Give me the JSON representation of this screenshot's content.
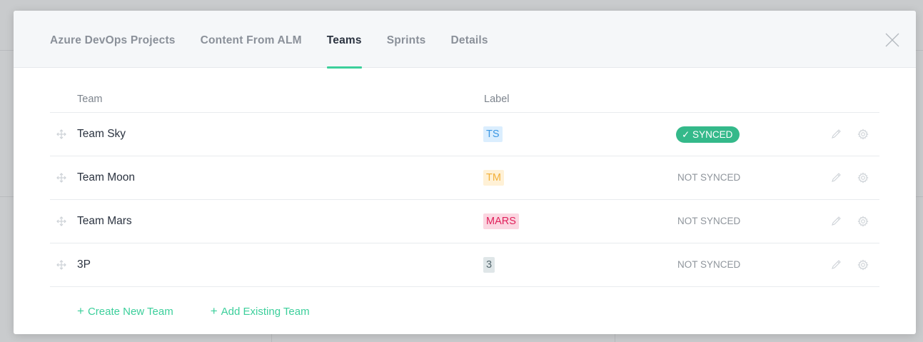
{
  "tabs": [
    {
      "label": "Azure DevOps Projects"
    },
    {
      "label": "Content From ALM"
    },
    {
      "label": "Teams"
    },
    {
      "label": "Sprints"
    },
    {
      "label": "Details"
    }
  ],
  "active_tab": "Teams",
  "table": {
    "headers": {
      "team": "Team",
      "label": "Label"
    },
    "rows": [
      {
        "name": "Team Sky",
        "label": "TS",
        "label_bg": "#dbeefe",
        "label_color": "#3b97e3",
        "status": "✓ SYNCED",
        "synced": true
      },
      {
        "name": "Team Moon",
        "label": "TM",
        "label_bg": "#fff1d6",
        "label_color": "#f2b03a",
        "status": "NOT SYNCED",
        "synced": false
      },
      {
        "name": "Team Mars",
        "label": "MARS",
        "label_bg": "#fbd6e1",
        "label_color": "#e0215b",
        "status": "NOT SYNCED",
        "synced": false
      },
      {
        "name": "3P",
        "label": "3",
        "label_bg": "#dfe6e8",
        "label_color": "#56696f",
        "status": "NOT SYNCED",
        "synced": false
      }
    ]
  },
  "actions": {
    "create_new_team": "Create New Team",
    "add_existing_team": "Add Existing Team"
  },
  "colors": {
    "accent": "#3ccf9b",
    "synced_pill": "#34b98a"
  },
  "icons": {
    "close": "close-icon",
    "drag": "drag-handle-icon",
    "edit": "pencil-icon",
    "settings": "gear-icon",
    "add": "plus-icon"
  }
}
